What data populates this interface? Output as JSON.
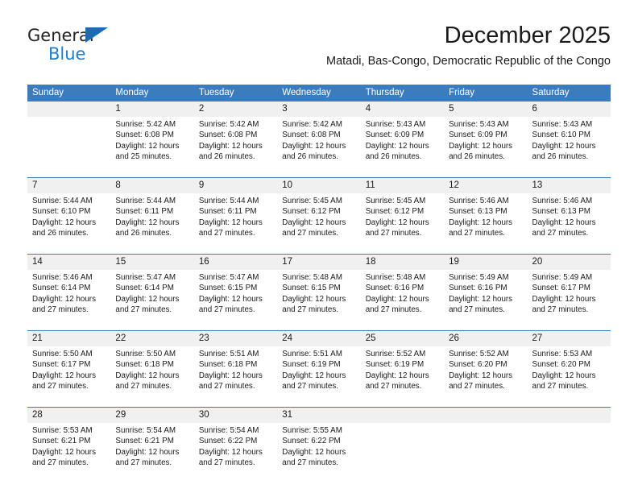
{
  "brand": {
    "name_part1": "General",
    "name_part2": "Blue",
    "accent_color": "#1b7fd4",
    "triangle_color": "#1b6cb5"
  },
  "header": {
    "title": "December 2025",
    "subtitle": "Matadi, Bas-Congo, Democratic Republic of the Congo"
  },
  "calendar": {
    "header_bg": "#3b7cbf",
    "daynum_bg": "#f0f0f0",
    "weekdays": [
      "Sunday",
      "Monday",
      "Tuesday",
      "Wednesday",
      "Thursday",
      "Friday",
      "Saturday"
    ],
    "weeks": [
      [
        {
          "day": "",
          "sunrise": "",
          "sunset": "",
          "daylight_line1": "",
          "daylight_line2": ""
        },
        {
          "day": "1",
          "sunrise": "Sunrise: 5:42 AM",
          "sunset": "Sunset: 6:08 PM",
          "daylight_line1": "Daylight: 12 hours",
          "daylight_line2": "and 25 minutes."
        },
        {
          "day": "2",
          "sunrise": "Sunrise: 5:42 AM",
          "sunset": "Sunset: 6:08 PM",
          "daylight_line1": "Daylight: 12 hours",
          "daylight_line2": "and 26 minutes."
        },
        {
          "day": "3",
          "sunrise": "Sunrise: 5:42 AM",
          "sunset": "Sunset: 6:08 PM",
          "daylight_line1": "Daylight: 12 hours",
          "daylight_line2": "and 26 minutes."
        },
        {
          "day": "4",
          "sunrise": "Sunrise: 5:43 AM",
          "sunset": "Sunset: 6:09 PM",
          "daylight_line1": "Daylight: 12 hours",
          "daylight_line2": "and 26 minutes."
        },
        {
          "day": "5",
          "sunrise": "Sunrise: 5:43 AM",
          "sunset": "Sunset: 6:09 PM",
          "daylight_line1": "Daylight: 12 hours",
          "daylight_line2": "and 26 minutes."
        },
        {
          "day": "6",
          "sunrise": "Sunrise: 5:43 AM",
          "sunset": "Sunset: 6:10 PM",
          "daylight_line1": "Daylight: 12 hours",
          "daylight_line2": "and 26 minutes."
        }
      ],
      [
        {
          "day": "7",
          "sunrise": "Sunrise: 5:44 AM",
          "sunset": "Sunset: 6:10 PM",
          "daylight_line1": "Daylight: 12 hours",
          "daylight_line2": "and 26 minutes."
        },
        {
          "day": "8",
          "sunrise": "Sunrise: 5:44 AM",
          "sunset": "Sunset: 6:11 PM",
          "daylight_line1": "Daylight: 12 hours",
          "daylight_line2": "and 26 minutes."
        },
        {
          "day": "9",
          "sunrise": "Sunrise: 5:44 AM",
          "sunset": "Sunset: 6:11 PM",
          "daylight_line1": "Daylight: 12 hours",
          "daylight_line2": "and 27 minutes."
        },
        {
          "day": "10",
          "sunrise": "Sunrise: 5:45 AM",
          "sunset": "Sunset: 6:12 PM",
          "daylight_line1": "Daylight: 12 hours",
          "daylight_line2": "and 27 minutes."
        },
        {
          "day": "11",
          "sunrise": "Sunrise: 5:45 AM",
          "sunset": "Sunset: 6:12 PM",
          "daylight_line1": "Daylight: 12 hours",
          "daylight_line2": "and 27 minutes."
        },
        {
          "day": "12",
          "sunrise": "Sunrise: 5:46 AM",
          "sunset": "Sunset: 6:13 PM",
          "daylight_line1": "Daylight: 12 hours",
          "daylight_line2": "and 27 minutes."
        },
        {
          "day": "13",
          "sunrise": "Sunrise: 5:46 AM",
          "sunset": "Sunset: 6:13 PM",
          "daylight_line1": "Daylight: 12 hours",
          "daylight_line2": "and 27 minutes."
        }
      ],
      [
        {
          "day": "14",
          "sunrise": "Sunrise: 5:46 AM",
          "sunset": "Sunset: 6:14 PM",
          "daylight_line1": "Daylight: 12 hours",
          "daylight_line2": "and 27 minutes."
        },
        {
          "day": "15",
          "sunrise": "Sunrise: 5:47 AM",
          "sunset": "Sunset: 6:14 PM",
          "daylight_line1": "Daylight: 12 hours",
          "daylight_line2": "and 27 minutes."
        },
        {
          "day": "16",
          "sunrise": "Sunrise: 5:47 AM",
          "sunset": "Sunset: 6:15 PM",
          "daylight_line1": "Daylight: 12 hours",
          "daylight_line2": "and 27 minutes."
        },
        {
          "day": "17",
          "sunrise": "Sunrise: 5:48 AM",
          "sunset": "Sunset: 6:15 PM",
          "daylight_line1": "Daylight: 12 hours",
          "daylight_line2": "and 27 minutes."
        },
        {
          "day": "18",
          "sunrise": "Sunrise: 5:48 AM",
          "sunset": "Sunset: 6:16 PM",
          "daylight_line1": "Daylight: 12 hours",
          "daylight_line2": "and 27 minutes."
        },
        {
          "day": "19",
          "sunrise": "Sunrise: 5:49 AM",
          "sunset": "Sunset: 6:16 PM",
          "daylight_line1": "Daylight: 12 hours",
          "daylight_line2": "and 27 minutes."
        },
        {
          "day": "20",
          "sunrise": "Sunrise: 5:49 AM",
          "sunset": "Sunset: 6:17 PM",
          "daylight_line1": "Daylight: 12 hours",
          "daylight_line2": "and 27 minutes."
        }
      ],
      [
        {
          "day": "21",
          "sunrise": "Sunrise: 5:50 AM",
          "sunset": "Sunset: 6:17 PM",
          "daylight_line1": "Daylight: 12 hours",
          "daylight_line2": "and 27 minutes."
        },
        {
          "day": "22",
          "sunrise": "Sunrise: 5:50 AM",
          "sunset": "Sunset: 6:18 PM",
          "daylight_line1": "Daylight: 12 hours",
          "daylight_line2": "and 27 minutes."
        },
        {
          "day": "23",
          "sunrise": "Sunrise: 5:51 AM",
          "sunset": "Sunset: 6:18 PM",
          "daylight_line1": "Daylight: 12 hours",
          "daylight_line2": "and 27 minutes."
        },
        {
          "day": "24",
          "sunrise": "Sunrise: 5:51 AM",
          "sunset": "Sunset: 6:19 PM",
          "daylight_line1": "Daylight: 12 hours",
          "daylight_line2": "and 27 minutes."
        },
        {
          "day": "25",
          "sunrise": "Sunrise: 5:52 AM",
          "sunset": "Sunset: 6:19 PM",
          "daylight_line1": "Daylight: 12 hours",
          "daylight_line2": "and 27 minutes."
        },
        {
          "day": "26",
          "sunrise": "Sunrise: 5:52 AM",
          "sunset": "Sunset: 6:20 PM",
          "daylight_line1": "Daylight: 12 hours",
          "daylight_line2": "and 27 minutes."
        },
        {
          "day": "27",
          "sunrise": "Sunrise: 5:53 AM",
          "sunset": "Sunset: 6:20 PM",
          "daylight_line1": "Daylight: 12 hours",
          "daylight_line2": "and 27 minutes."
        }
      ],
      [
        {
          "day": "28",
          "sunrise": "Sunrise: 5:53 AM",
          "sunset": "Sunset: 6:21 PM",
          "daylight_line1": "Daylight: 12 hours",
          "daylight_line2": "and 27 minutes."
        },
        {
          "day": "29",
          "sunrise": "Sunrise: 5:54 AM",
          "sunset": "Sunset: 6:21 PM",
          "daylight_line1": "Daylight: 12 hours",
          "daylight_line2": "and 27 minutes."
        },
        {
          "day": "30",
          "sunrise": "Sunrise: 5:54 AM",
          "sunset": "Sunset: 6:22 PM",
          "daylight_line1": "Daylight: 12 hours",
          "daylight_line2": "and 27 minutes."
        },
        {
          "day": "31",
          "sunrise": "Sunrise: 5:55 AM",
          "sunset": "Sunset: 6:22 PM",
          "daylight_line1": "Daylight: 12 hours",
          "daylight_line2": "and 27 minutes."
        },
        {
          "day": "",
          "sunrise": "",
          "sunset": "",
          "daylight_line1": "",
          "daylight_line2": ""
        },
        {
          "day": "",
          "sunrise": "",
          "sunset": "",
          "daylight_line1": "",
          "daylight_line2": ""
        },
        {
          "day": "",
          "sunrise": "",
          "sunset": "",
          "daylight_line1": "",
          "daylight_line2": ""
        }
      ]
    ]
  }
}
